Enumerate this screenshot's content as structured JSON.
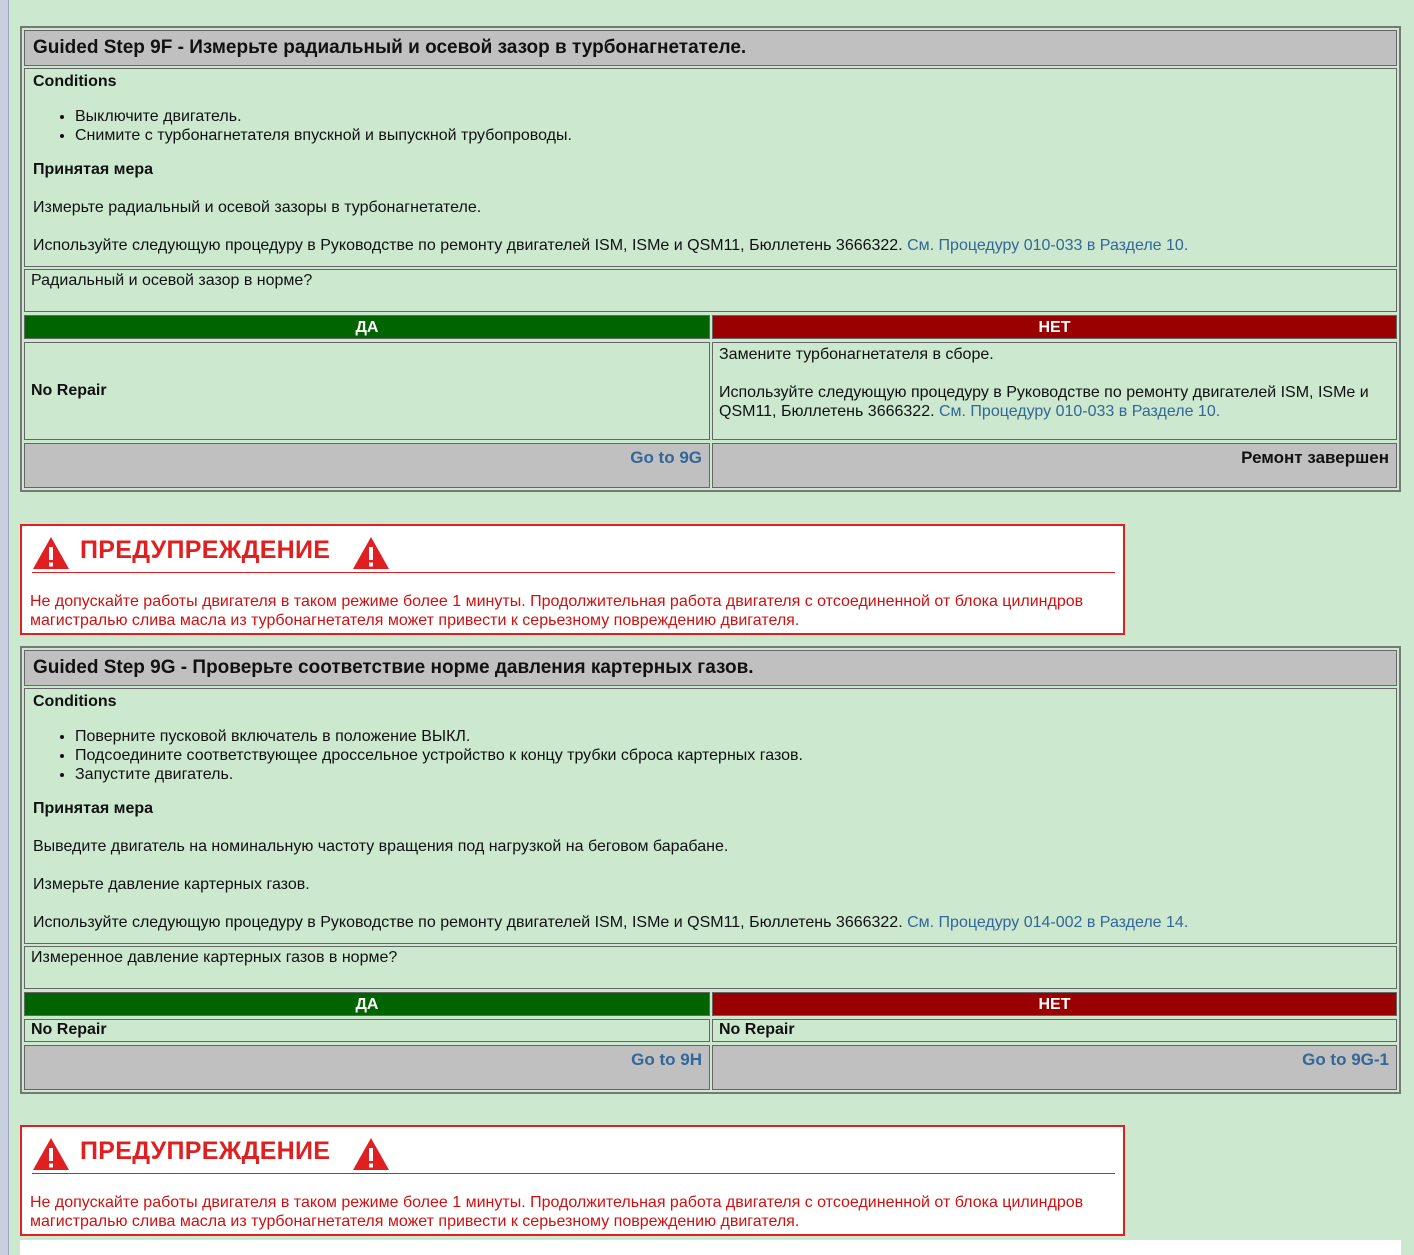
{
  "step9f": {
    "title_prefix": "Guided Step 9F - ",
    "title_rest": "Измерьте радиальный и осевой зазор в турбонагнетателе.",
    "conditions_label": "Conditions",
    "conditions": [
      "Выключите двигатель.",
      "Снимите с турбонагнетателя впускной и выпускной трубопроводы."
    ],
    "action_label": "Принятая мера",
    "action_lines": [
      "Измерьте радиальный и осевой зазоры в турбонагнетателе."
    ],
    "procedure_text": "Используйте следующую процедуру в Руководстве по ремонту двигателей ISM, ISMe и QSM11, Бюллетень 3666322. ",
    "procedure_link": "См. Процедуру 010-033 в Разделе 10.",
    "question": "Радиальный и осевой зазор в норме?",
    "yes_label": "ДА",
    "no_label": "НЕТ",
    "yes_result": "No Repair",
    "no_result_line1": "Замените турбонагнетателя в сборе.",
    "no_result_text": "Используйте следующую процедуру в Руководстве по ремонту двигателей ISM, ISMe и QSM11, Бюллетень 3666322. ",
    "no_result_link": "См. Процедуру 010-033 в Разделе 10.",
    "yes_nav": "Go to 9G",
    "no_nav": "Ремонт завершен"
  },
  "warning1": {
    "title": "ПРЕДУПРЕЖДЕНИЕ",
    "text": "Не допускайте работы двигателя в таком режиме более 1 минуты. Продолжительная работа двигателя с отсоединенной от блока цилиндров магистралью слива масла из турбонагнетателя может привести к серьезному повреждению двигателя."
  },
  "step9g": {
    "title_prefix": "Guided Step 9G - ",
    "title_rest": "Проверьте соответствие норме давления картерных газов.",
    "conditions_label": "Conditions",
    "conditions": [
      "Поверните пусковой включатель в положение ВЫКЛ.",
      "Подсоедините соответствующее дроссельное устройство к концу трубки сброса картерных газов.",
      "Запустите двигатель."
    ],
    "action_label": "Принятая мера",
    "action_lines": [
      "Выведите двигатель на номинальную частоту вращения под нагрузкой на беговом барабане.",
      "Измерьте давление картерных газов."
    ],
    "procedure_text": "Используйте следующую процедуру в Руководстве по ремонту двигателей ISM, ISMe и QSM11, Бюллетень 3666322. ",
    "procedure_link": "См. Процедуру 014-002 в Разделе 14.",
    "question": "Измеренное давление картерных газов в норме?",
    "yes_label": "ДА",
    "no_label": "НЕТ",
    "yes_result": "No Repair",
    "no_result": "No Repair",
    "yes_nav": "Go to 9H",
    "no_nav": "Go to 9G-1"
  },
  "warning2": {
    "title": "ПРЕДУПРЕЖДЕНИЕ",
    "text": "Не допускайте работы двигателя в таком режиме более 1 минуты. Продолжительная работа двигателя с отсоединенной от блока цилиндров магистралью слива масла из турбонагнетателя может привести к серьезному повреждению двигателя."
  },
  "colors": {
    "background": "#cce8cf",
    "yes": "#006400",
    "no": "#990000",
    "warning": "#e02020",
    "link": "#336699"
  },
  "icons": [
    "warning-triangle-icon"
  ]
}
